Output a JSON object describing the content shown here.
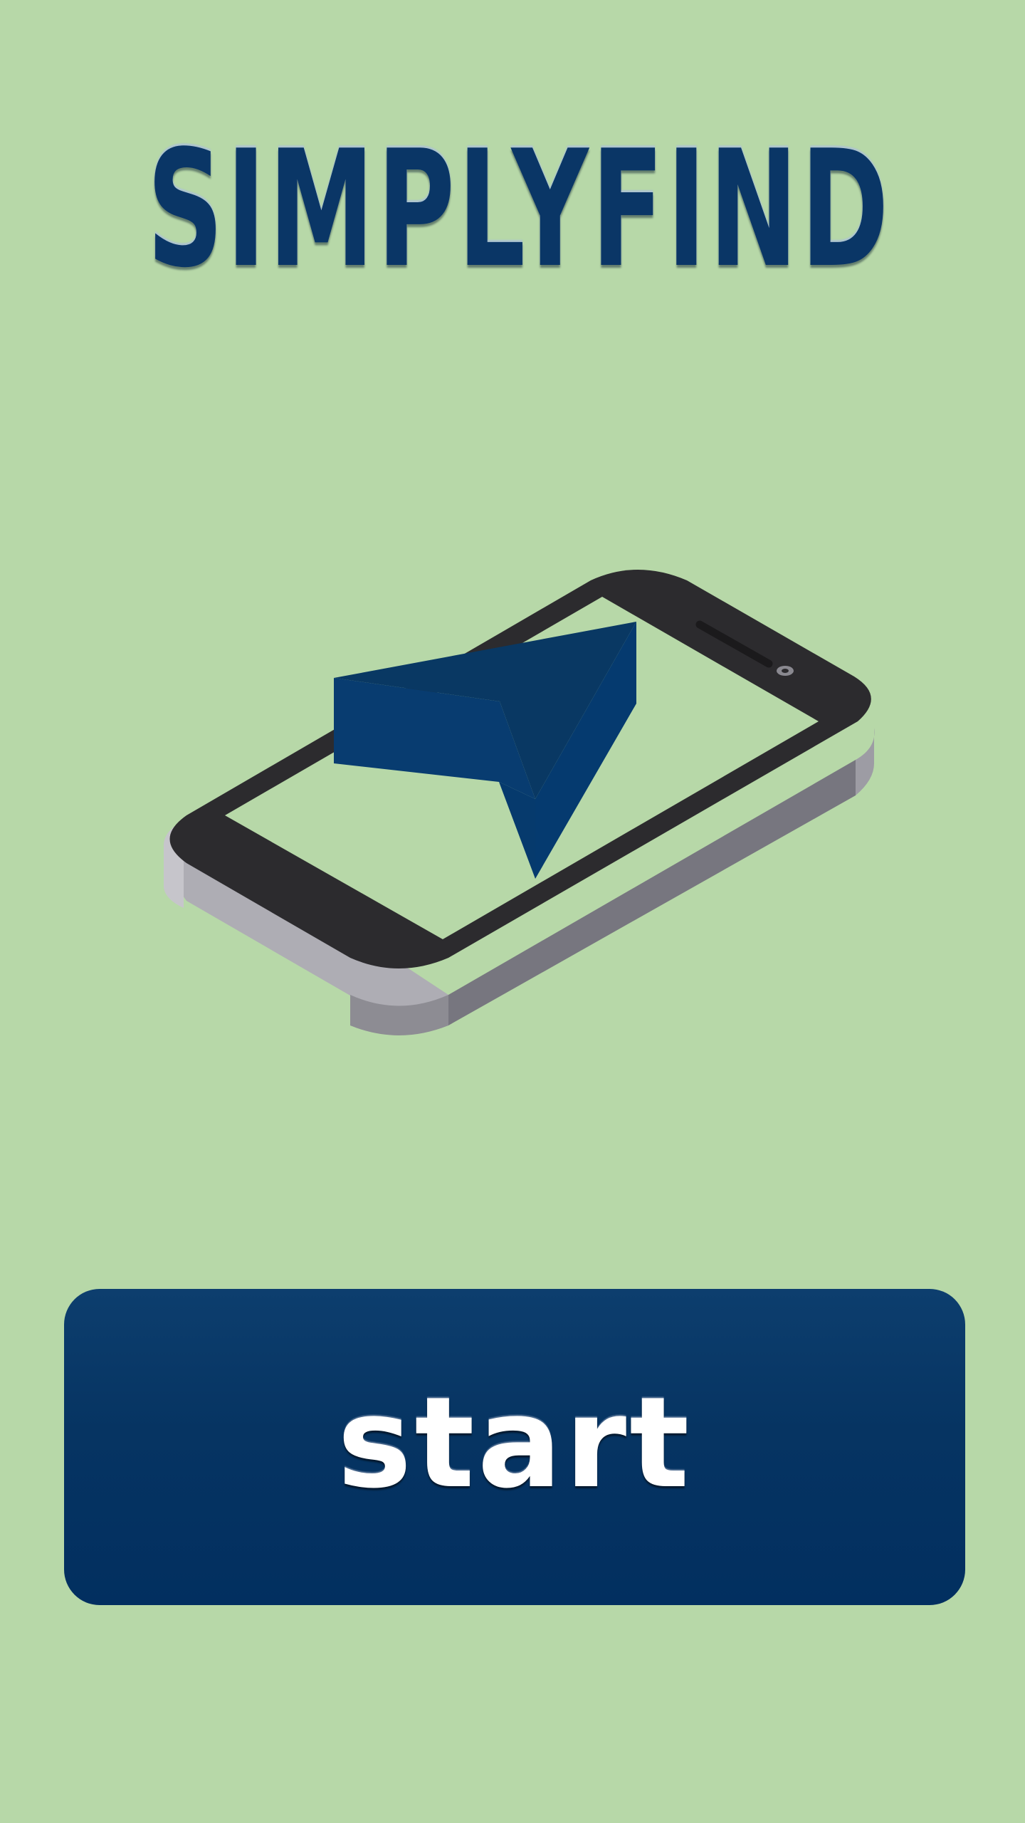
{
  "app": {
    "title": "SIMPLYFIND"
  },
  "hero": {
    "icon": "phone-with-navigation-arrow-icon"
  },
  "start_button": {
    "label": "start"
  },
  "colors": {
    "background": "#b7d8a8",
    "brand_blue": "#0a3666",
    "button_blue": "#063462",
    "phone_dark": "#2c2b2e",
    "phone_side": "#8b8a91"
  }
}
